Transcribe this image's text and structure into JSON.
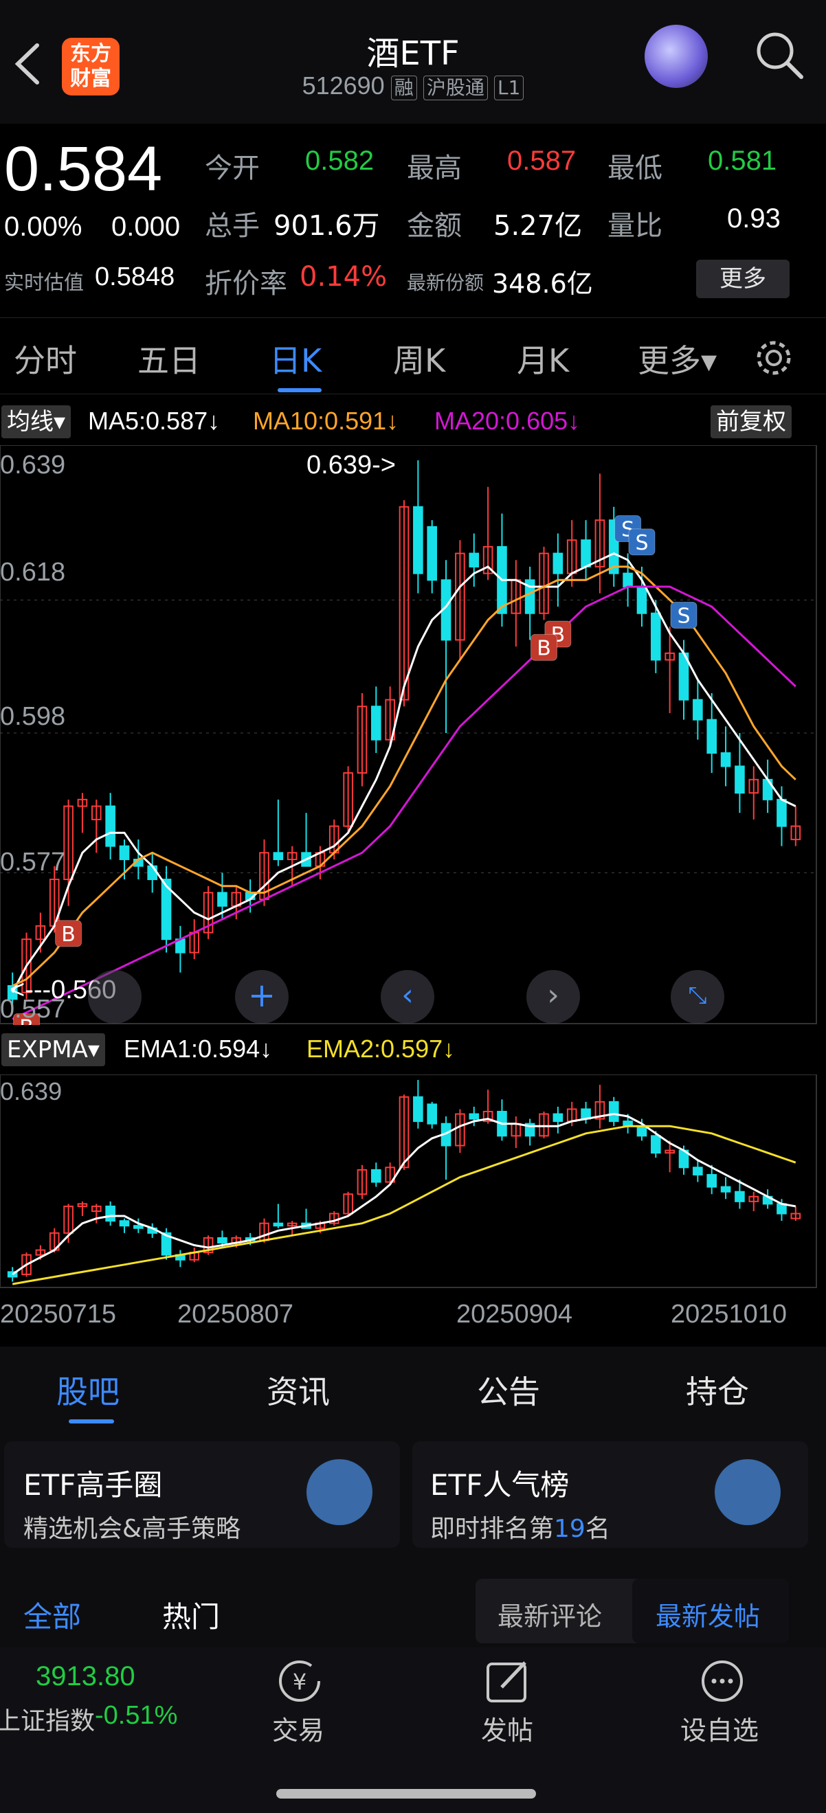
{
  "header": {
    "logo_text": "东方\n财富",
    "title": "酒ETF",
    "code": "512690",
    "tags": [
      "融",
      "沪股通",
      "L1"
    ]
  },
  "quote": {
    "price": "0.584",
    "change_pct": "0.00%",
    "change": "0.000",
    "fields": {
      "open_label": "今开",
      "open": "0.582",
      "high_label": "最高",
      "high": "0.587",
      "low_label": "最低",
      "low": "0.581",
      "volume_label": "总手",
      "volume": "901.6万",
      "amount_label": "金额",
      "amount": "5.27亿",
      "ratio_label": "量比",
      "ratio": "0.93",
      "iopv_label": "实时估值",
      "iopv": "0.5848",
      "discount_label": "折价率",
      "discount": "0.14%",
      "shares_label": "最新份额",
      "shares": "348.6亿"
    },
    "more_button": "更多"
  },
  "tabs": [
    "分时",
    "五日",
    "日K",
    "周K",
    "月K",
    "更多▾"
  ],
  "active_tab": "日K",
  "ma_bar": {
    "selector": "均线▾",
    "ma5": "MA5:0.587↓",
    "ma10": "MA10:0.591↓",
    "ma20": "MA20:0.605↓",
    "adjust": "前复权"
  },
  "ema_bar": {
    "selector": "EXPMA▾",
    "ema1": "EMA1:0.594↓",
    "ema2": "EMA2:0.597↓"
  },
  "price_axis": [
    "0.639",
    "0.618",
    "0.598",
    "0.577",
    "0.557"
  ],
  "ema_axis_top": "0.639",
  "annotations": {
    "high_label": "0.639->",
    "low_label": "<---0.560"
  },
  "dates": [
    "20250715",
    "20250807",
    "20250904",
    "20251010"
  ],
  "colors": {
    "up": "#ff3b3b",
    "down": "#18e0e8",
    "ma5": "#ffffff",
    "ma10": "#ffa62b",
    "ma20": "#d417d4",
    "ema1": "#ffffff",
    "ema2": "#f5e02a",
    "accent": "#3d8bff"
  },
  "chart_data": {
    "type": "candlestick",
    "ylim": [
      0.557,
      0.639
    ],
    "candles": [
      {
        "o": 0.56,
        "h": 0.562,
        "l": 0.556,
        "c": 0.558
      },
      {
        "o": 0.559,
        "h": 0.568,
        "l": 0.558,
        "c": 0.567
      },
      {
        "o": 0.567,
        "h": 0.571,
        "l": 0.565,
        "c": 0.569
      },
      {
        "o": 0.569,
        "h": 0.578,
        "l": 0.568,
        "c": 0.576
      },
      {
        "o": 0.576,
        "h": 0.588,
        "l": 0.572,
        "c": 0.587
      },
      {
        "o": 0.587,
        "h": 0.589,
        "l": 0.583,
        "c": 0.588
      },
      {
        "o": 0.585,
        "h": 0.588,
        "l": 0.58,
        "c": 0.587
      },
      {
        "o": 0.587,
        "h": 0.589,
        "l": 0.579,
        "c": 0.581
      },
      {
        "o": 0.581,
        "h": 0.582,
        "l": 0.576,
        "c": 0.579
      },
      {
        "o": 0.579,
        "h": 0.582,
        "l": 0.576,
        "c": 0.578
      },
      {
        "o": 0.578,
        "h": 0.58,
        "l": 0.574,
        "c": 0.576
      },
      {
        "o": 0.576,
        "h": 0.578,
        "l": 0.565,
        "c": 0.567
      },
      {
        "o": 0.567,
        "h": 0.569,
        "l": 0.562,
        "c": 0.565
      },
      {
        "o": 0.565,
        "h": 0.57,
        "l": 0.564,
        "c": 0.568
      },
      {
        "o": 0.568,
        "h": 0.575,
        "l": 0.567,
        "c": 0.574
      },
      {
        "o": 0.574,
        "h": 0.577,
        "l": 0.57,
        "c": 0.572
      },
      {
        "o": 0.572,
        "h": 0.575,
        "l": 0.57,
        "c": 0.574
      },
      {
        "o": 0.574,
        "h": 0.576,
        "l": 0.571,
        "c": 0.573
      },
      {
        "o": 0.573,
        "h": 0.582,
        "l": 0.572,
        "c": 0.58
      },
      {
        "o": 0.58,
        "h": 0.588,
        "l": 0.578,
        "c": 0.579
      },
      {
        "o": 0.579,
        "h": 0.581,
        "l": 0.575,
        "c": 0.58
      },
      {
        "o": 0.58,
        "h": 0.586,
        "l": 0.578,
        "c": 0.578
      },
      {
        "o": 0.578,
        "h": 0.581,
        "l": 0.576,
        "c": 0.58
      },
      {
        "o": 0.58,
        "h": 0.585,
        "l": 0.579,
        "c": 0.584
      },
      {
        "o": 0.584,
        "h": 0.593,
        "l": 0.583,
        "c": 0.592
      },
      {
        "o": 0.592,
        "h": 0.604,
        "l": 0.59,
        "c": 0.602
      },
      {
        "o": 0.602,
        "h": 0.605,
        "l": 0.595,
        "c": 0.597
      },
      {
        "o": 0.597,
        "h": 0.605,
        "l": 0.596,
        "c": 0.603
      },
      {
        "o": 0.603,
        "h": 0.633,
        "l": 0.602,
        "c": 0.632
      },
      {
        "o": 0.632,
        "h": 0.639,
        "l": 0.619,
        "c": 0.622
      },
      {
        "o": 0.629,
        "h": 0.63,
        "l": 0.619,
        "c": 0.621
      },
      {
        "o": 0.621,
        "h": 0.624,
        "l": 0.598,
        "c": 0.612
      },
      {
        "o": 0.612,
        "h": 0.627,
        "l": 0.609,
        "c": 0.625
      },
      {
        "o": 0.625,
        "h": 0.628,
        "l": 0.62,
        "c": 0.623
      },
      {
        "o": 0.622,
        "h": 0.635,
        "l": 0.621,
        "c": 0.626
      },
      {
        "o": 0.626,
        "h": 0.631,
        "l": 0.614,
        "c": 0.616
      },
      {
        "o": 0.616,
        "h": 0.624,
        "l": 0.611,
        "c": 0.621
      },
      {
        "o": 0.621,
        "h": 0.623,
        "l": 0.612,
        "c": 0.616
      },
      {
        "o": 0.616,
        "h": 0.626,
        "l": 0.615,
        "c": 0.625
      },
      {
        "o": 0.625,
        "h": 0.628,
        "l": 0.617,
        "c": 0.622
      },
      {
        "o": 0.622,
        "h": 0.63,
        "l": 0.62,
        "c": 0.627
      },
      {
        "o": 0.627,
        "h": 0.63,
        "l": 0.621,
        "c": 0.623
      },
      {
        "o": 0.623,
        "h": 0.637,
        "l": 0.619,
        "c": 0.63
      },
      {
        "o": 0.63,
        "h": 0.632,
        "l": 0.62,
        "c": 0.622
      },
      {
        "o": 0.622,
        "h": 0.625,
        "l": 0.617,
        "c": 0.62
      },
      {
        "o": 0.62,
        "h": 0.623,
        "l": 0.614,
        "c": 0.616
      },
      {
        "o": 0.616,
        "h": 0.618,
        "l": 0.607,
        "c": 0.609
      },
      {
        "o": 0.609,
        "h": 0.614,
        "l": 0.601,
        "c": 0.61
      },
      {
        "o": 0.61,
        "h": 0.612,
        "l": 0.6,
        "c": 0.603
      },
      {
        "o": 0.603,
        "h": 0.606,
        "l": 0.597,
        "c": 0.6
      },
      {
        "o": 0.6,
        "h": 0.604,
        "l": 0.592,
        "c": 0.595
      },
      {
        "o": 0.595,
        "h": 0.599,
        "l": 0.59,
        "c": 0.593
      },
      {
        "o": 0.593,
        "h": 0.598,
        "l": 0.586,
        "c": 0.589
      },
      {
        "o": 0.589,
        "h": 0.593,
        "l": 0.585,
        "c": 0.591
      },
      {
        "o": 0.591,
        "h": 0.594,
        "l": 0.586,
        "c": 0.588
      },
      {
        "o": 0.588,
        "h": 0.59,
        "l": 0.581,
        "c": 0.584
      },
      {
        "o": 0.582,
        "h": 0.587,
        "l": 0.581,
        "c": 0.584
      }
    ],
    "ma5": [
      0.559,
      0.563,
      0.566,
      0.569,
      0.575,
      0.58,
      0.582,
      0.583,
      0.583,
      0.58,
      0.578,
      0.575,
      0.573,
      0.571,
      0.57,
      0.571,
      0.572,
      0.573,
      0.575,
      0.577,
      0.578,
      0.579,
      0.58,
      0.581,
      0.583,
      0.587,
      0.591,
      0.596,
      0.605,
      0.611,
      0.615,
      0.617,
      0.62,
      0.622,
      0.623,
      0.621,
      0.621,
      0.62,
      0.62,
      0.62,
      0.622,
      0.623,
      0.624,
      0.625,
      0.624,
      0.621,
      0.617,
      0.613,
      0.61,
      0.606,
      0.603,
      0.6,
      0.597,
      0.594,
      0.591,
      0.588,
      0.587
    ],
    "ma10": [
      0.56,
      0.561,
      0.563,
      0.565,
      0.568,
      0.571,
      0.573,
      0.575,
      0.577,
      0.579,
      0.58,
      0.579,
      0.578,
      0.577,
      0.576,
      0.575,
      0.575,
      0.574,
      0.574,
      0.575,
      0.576,
      0.577,
      0.578,
      0.58,
      0.582,
      0.584,
      0.587,
      0.59,
      0.594,
      0.598,
      0.602,
      0.606,
      0.609,
      0.612,
      0.615,
      0.617,
      0.618,
      0.619,
      0.62,
      0.621,
      0.621,
      0.621,
      0.622,
      0.623,
      0.623,
      0.622,
      0.62,
      0.618,
      0.616,
      0.613,
      0.61,
      0.607,
      0.603,
      0.599,
      0.596,
      0.593,
      0.591
    ],
    "ma20": [
      0.555,
      0.556,
      0.557,
      0.558,
      0.559,
      0.56,
      0.561,
      0.562,
      0.563,
      0.564,
      0.565,
      0.566,
      0.567,
      0.568,
      0.569,
      0.57,
      0.571,
      0.572,
      0.573,
      0.574,
      0.575,
      0.576,
      0.577,
      0.578,
      0.579,
      0.58,
      0.582,
      0.584,
      0.587,
      0.59,
      0.593,
      0.596,
      0.599,
      0.601,
      0.603,
      0.605,
      0.607,
      0.609,
      0.611,
      0.613,
      0.615,
      0.617,
      0.618,
      0.619,
      0.62,
      0.62,
      0.62,
      0.62,
      0.619,
      0.618,
      0.617,
      0.615,
      0.613,
      0.611,
      0.609,
      0.607,
      0.605
    ],
    "signals": [
      {
        "i": 1,
        "t": "B"
      },
      {
        "i": 4,
        "t": "B"
      },
      {
        "i": 44,
        "t": "S"
      },
      {
        "i": 48,
        "t": "S"
      },
      {
        "i": 39,
        "t": "B"
      },
      {
        "i": 38,
        "t": "B"
      },
      {
        "i": 45,
        "t": "S"
      }
    ]
  },
  "bottom_tabs": [
    "股吧",
    "资讯",
    "公告",
    "持仓"
  ],
  "active_bottom_tab": "股吧",
  "cards": [
    {
      "title": "ETF高手圈",
      "subtitle": "精选机会&高手策略"
    },
    {
      "title": "ETF人气榜",
      "subtitle_pre": "即时排名第",
      "rank": "19",
      "subtitle_post": "名"
    }
  ],
  "filters": {
    "all": "全部",
    "hot": "热门",
    "latest_comment": "最新评论",
    "latest_post": "最新发帖"
  },
  "footer": {
    "index_value": "3913.80",
    "index_name": "上证指数",
    "index_change": "-0.51%",
    "trade": "交易",
    "post": "发帖",
    "watch": "设自选"
  }
}
